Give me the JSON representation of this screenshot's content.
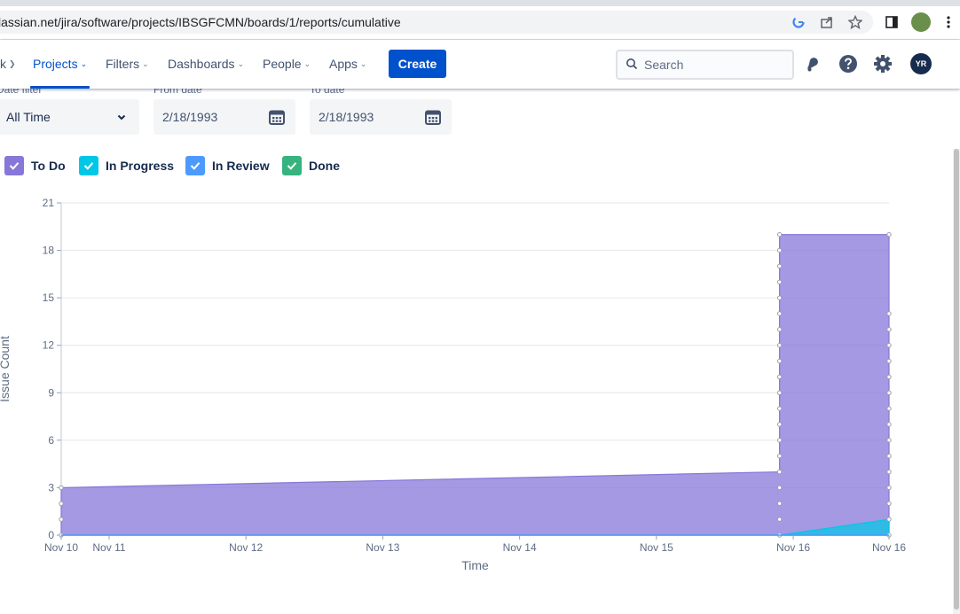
{
  "browser": {
    "url": "lassian.net/jira/software/projects/IBSGFCMN/boards/1/reports/cumulative"
  },
  "nav": {
    "partial_item": "k",
    "items": [
      "Projects",
      "Filters",
      "Dashboards",
      "People",
      "Apps"
    ],
    "create_label": "Create",
    "search_placeholder": "Search",
    "avatar_initials": "YR"
  },
  "filters": {
    "date_filter_label": "Date filter",
    "date_filter_value": "All Time",
    "from_label": "From date",
    "from_value": "2/18/1993",
    "to_label": "To date",
    "to_value": "2/18/1993"
  },
  "legend": [
    {
      "label": "To Do",
      "color": "#8777d9"
    },
    {
      "label": "In Progress",
      "color": "#00c7e6"
    },
    {
      "label": "In Review",
      "color": "#4c9aff"
    },
    {
      "label": "Done",
      "color": "#36b37e"
    }
  ],
  "chart_data": {
    "type": "area",
    "xlabel": "Time",
    "ylabel": "Issue Count",
    "ylim": [
      0,
      21
    ],
    "yticks": [
      0,
      3,
      6,
      9,
      12,
      15,
      18,
      21
    ],
    "xtick_labels": [
      "Nov 10",
      "Nov 11",
      "Nov 12",
      "Nov 13",
      "Nov 14",
      "Nov 15",
      "Nov 16",
      "Nov 16"
    ],
    "x_days": [
      10,
      10.35,
      11.35,
      12.35,
      13.35,
      14.35,
      15.35,
      16.05
    ],
    "series": [
      {
        "name": "To Do",
        "color": "#8777d9",
        "points": [
          [
            10,
            3
          ],
          [
            15.25,
            4
          ],
          [
            15.25,
            19
          ],
          [
            16.05,
            19
          ],
          [
            16.05,
            1
          ]
        ]
      },
      {
        "name": "In Progress",
        "color": "#00c7e6",
        "points": [
          [
            15.25,
            0
          ],
          [
            16.05,
            1
          ]
        ]
      }
    ],
    "grid": true
  }
}
